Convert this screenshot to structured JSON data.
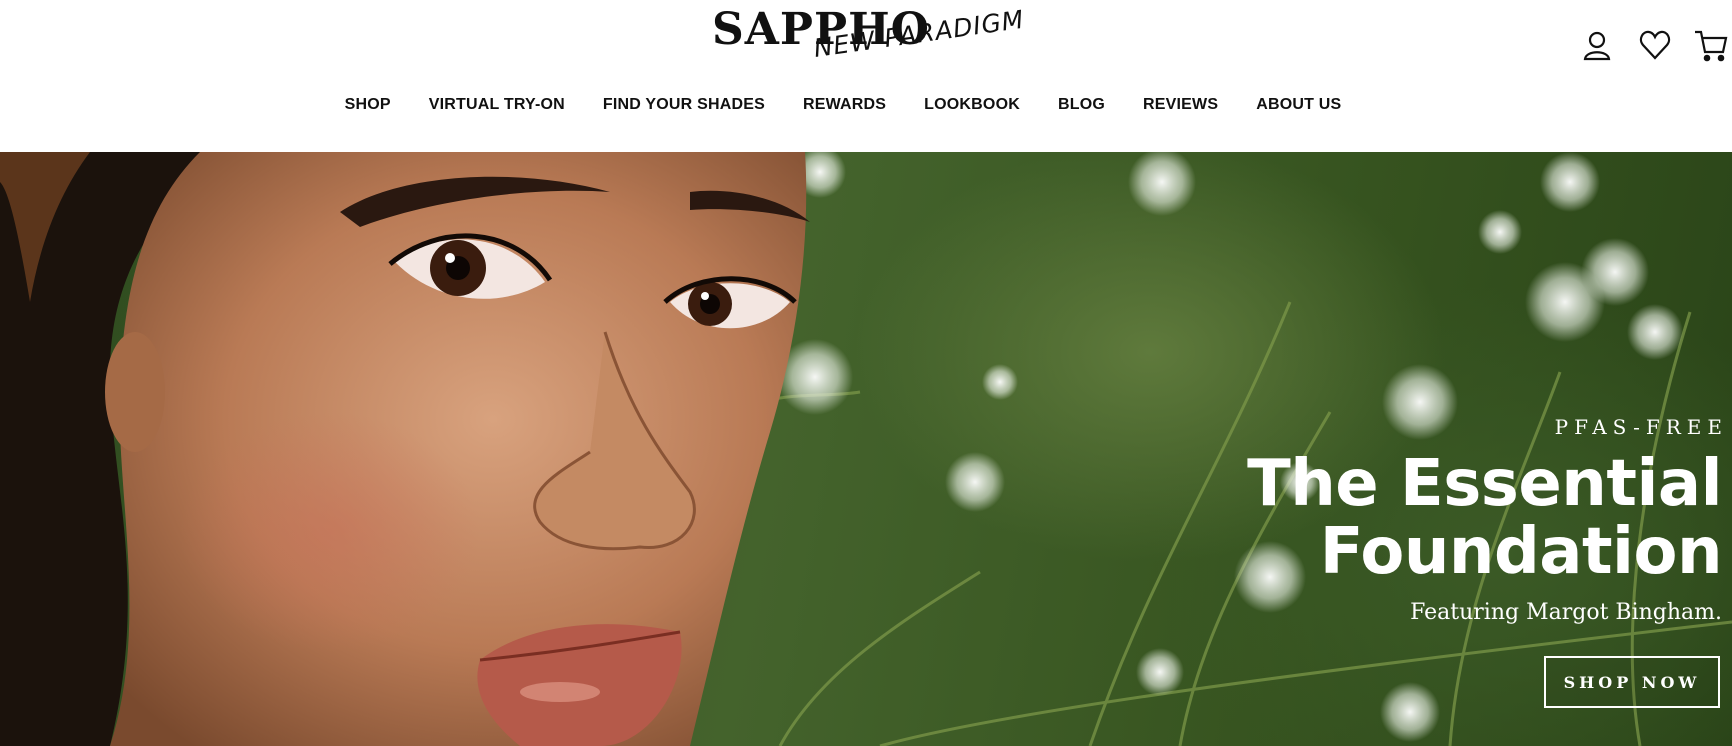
{
  "brand": {
    "name": "SAPPHO",
    "tagline": "NEW PARADIGM"
  },
  "header_icons": [
    {
      "name": "account-icon",
      "label": "Account"
    },
    {
      "name": "wishlist-heart-icon",
      "label": "Wishlist"
    },
    {
      "name": "cart-icon",
      "label": "Cart"
    }
  ],
  "nav": {
    "items": [
      {
        "label": "SHOP"
      },
      {
        "label": "VIRTUAL TRY-ON"
      },
      {
        "label": "FIND YOUR SHADES"
      },
      {
        "label": "REWARDS"
      },
      {
        "label": "LOOKBOOK"
      },
      {
        "label": "BLOG"
      },
      {
        "label": "REVIEWS"
      },
      {
        "label": "ABOUT US"
      }
    ]
  },
  "hero": {
    "eyebrow": "PFAS-FREE",
    "headline_line1": "The Essential",
    "headline_line2": "Foundation",
    "subline": "Featuring Margot Bingham.",
    "cta_label": "SHOP NOW"
  },
  "colors": {
    "text": "#111111",
    "hero_text": "#ffffff",
    "foliage_dark": "#2d4a1e",
    "foliage_mid": "#44632c"
  }
}
